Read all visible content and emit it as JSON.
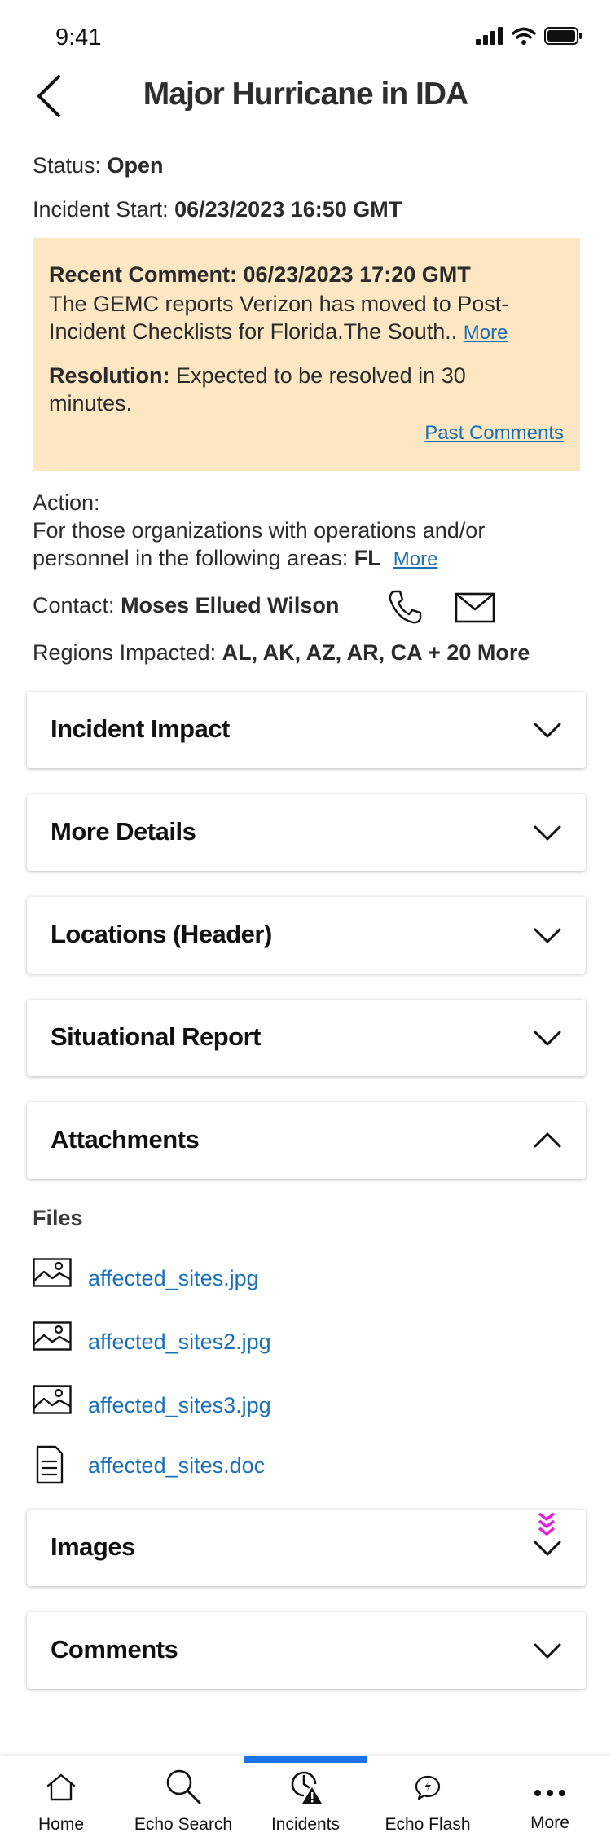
{
  "status_bar": {
    "time": "9:41"
  },
  "header": {
    "title": "Major Hurricane in IDA"
  },
  "status": {
    "label": "Status: ",
    "value": "Open"
  },
  "incident_start": {
    "label": "Incident Start: ",
    "value": "06/23/2023 16:50 GMT"
  },
  "recent_comment": {
    "heading": "Recent Comment: 06/23/2023 17:20 GMT",
    "text": "The GEMC reports Verizon has moved to Post-Incident Checklists for Florida.The South..",
    "more_label": "More",
    "resolution_label": "Resolution:",
    "resolution_text": " Expected to be resolved in 30 minutes.",
    "past_comments_label": "Past Comments"
  },
  "action": {
    "label": "Action:",
    "text": "For those organizations with operations and/or personnel in the following areas: ",
    "areas": "FL",
    "more_label": "More"
  },
  "contact": {
    "label": "Contact: ",
    "name": "Moses Ellued Wilson"
  },
  "regions": {
    "label": "Regions Impacted: ",
    "value": "AL, AK, AZ, AR, CA + 20 More"
  },
  "sections": [
    {
      "label": "Incident Impact",
      "expanded": false
    },
    {
      "label": "More Details",
      "expanded": false
    },
    {
      "label": "Locations (Header)",
      "expanded": false
    },
    {
      "label": "Situational Report",
      "expanded": false
    },
    {
      "label": "Attachments",
      "expanded": true
    },
    {
      "label": "Images",
      "expanded": false
    },
    {
      "label": "Comments",
      "expanded": false
    }
  ],
  "attachments": {
    "files_label": "Files",
    "files": [
      {
        "name": "affected_sites.jpg",
        "icon": "image-file-icon"
      },
      {
        "name": "affected_sites2.jpg",
        "icon": "image-file-icon"
      },
      {
        "name": "affected_sites3.jpg",
        "icon": "image-file-icon"
      },
      {
        "name": "affected_sites.doc",
        "icon": "document-file-icon"
      }
    ]
  },
  "bottom_nav": {
    "active_index": 2,
    "active_color": "#1a73e8",
    "items": [
      {
        "label": "Home",
        "icon": "home-icon"
      },
      {
        "label": "Echo Search",
        "icon": "search-icon"
      },
      {
        "label": "Incidents",
        "icon": "incidents-icon"
      },
      {
        "label": "Echo Flash",
        "icon": "echo-flash-icon"
      },
      {
        "label": "More",
        "icon": "more-dots-icon"
      }
    ]
  },
  "colors": {
    "link": "#1a6fb5",
    "comment_background": "#fde7c2",
    "scroll_indicator": "#e020e0"
  }
}
